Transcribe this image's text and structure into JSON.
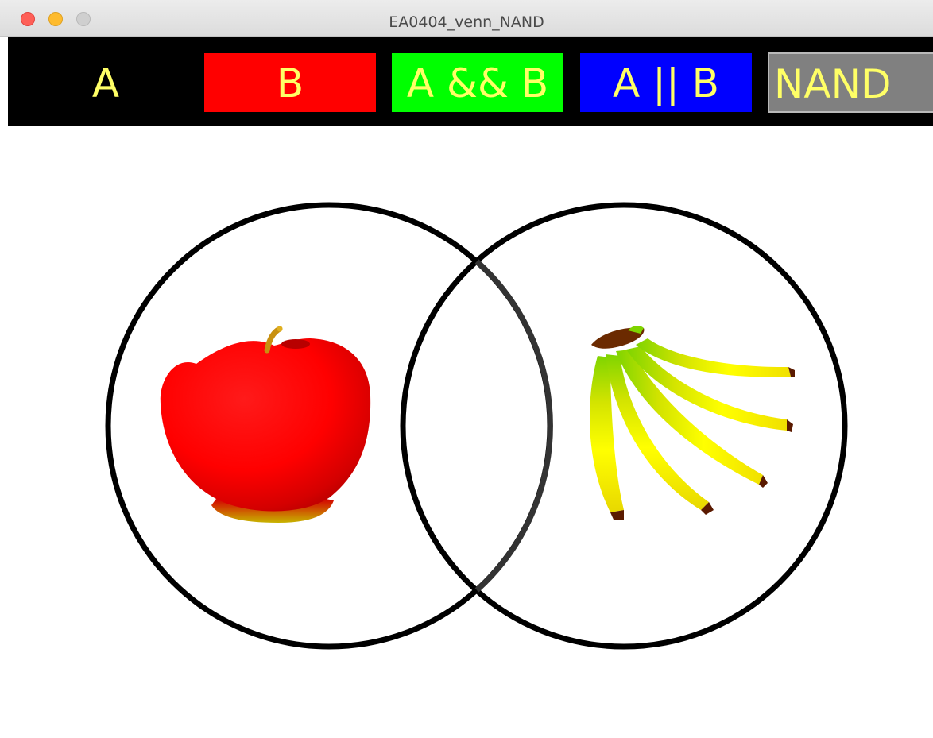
{
  "window": {
    "title": "EA0404_venn_NAND"
  },
  "toolbar": {
    "buttons": [
      {
        "label": "A",
        "color": "#000000"
      },
      {
        "label": "B",
        "color": "#ff0000"
      },
      {
        "label": "A && B",
        "color": "#00ff00"
      },
      {
        "label": "A || B",
        "color": "#0000ff"
      },
      {
        "label": "NAND",
        "color": "#808080"
      }
    ],
    "text_color": "#ffff66"
  },
  "venn": {
    "set_a_item": "apple-icon",
    "set_b_item": "banana-bunch-icon",
    "outline_color": "#000000"
  }
}
